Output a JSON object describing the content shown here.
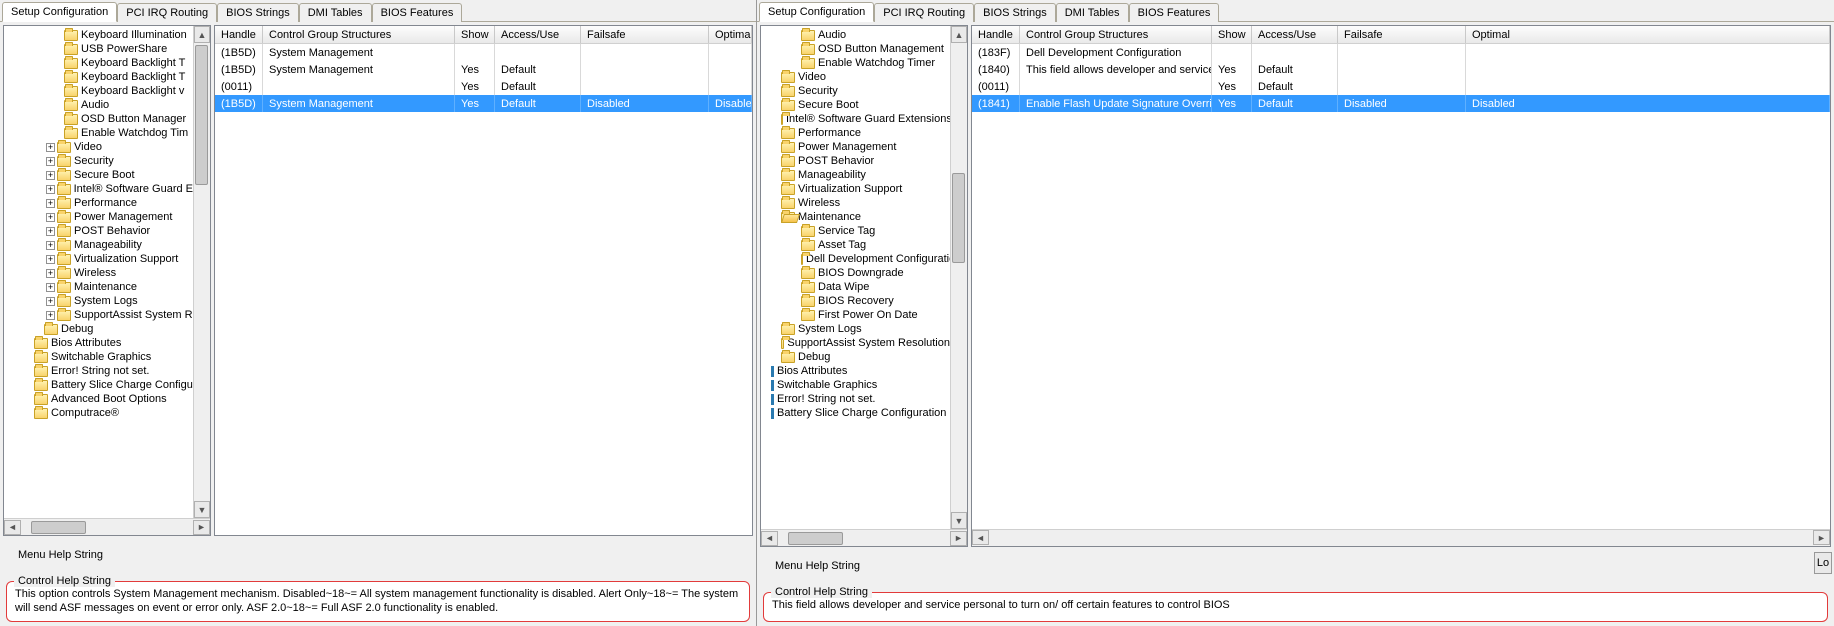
{
  "tabs": [
    "Setup Configuration",
    "PCI IRQ Routing",
    "BIOS Strings",
    "DMI Tables",
    "BIOS Features"
  ],
  "columns": [
    "Handle",
    "Control Group Structures",
    "Show",
    "Access/Use",
    "Failsafe",
    "Optimal"
  ],
  "left": {
    "tree": [
      {
        "indent": 6,
        "folder": "closed",
        "label": "Keyboard Illumination"
      },
      {
        "indent": 6,
        "folder": "closed",
        "label": "USB PowerShare"
      },
      {
        "indent": 6,
        "folder": "closed",
        "label": "Keyboard Backlight T"
      },
      {
        "indent": 6,
        "folder": "closed",
        "label": "Keyboard Backlight T"
      },
      {
        "indent": 6,
        "folder": "closed",
        "label": "Keyboard Backlight v"
      },
      {
        "indent": 6,
        "folder": "closed",
        "label": "Audio"
      },
      {
        "indent": 6,
        "folder": "closed",
        "label": "OSD Button Manager"
      },
      {
        "indent": 6,
        "folder": "closed",
        "label": "Enable Watchdog Tim"
      },
      {
        "indent": 4,
        "expander": "+",
        "folder": "closed",
        "label": "Video"
      },
      {
        "indent": 4,
        "expander": "+",
        "folder": "closed",
        "label": "Security"
      },
      {
        "indent": 4,
        "expander": "+",
        "folder": "closed",
        "label": "Secure Boot"
      },
      {
        "indent": 4,
        "expander": "+",
        "folder": "closed",
        "label": "Intel® Software Guard E"
      },
      {
        "indent": 4,
        "expander": "+",
        "folder": "closed",
        "label": "Performance"
      },
      {
        "indent": 4,
        "expander": "+",
        "folder": "closed",
        "label": "Power Management"
      },
      {
        "indent": 4,
        "expander": "+",
        "folder": "closed",
        "label": "POST Behavior"
      },
      {
        "indent": 4,
        "expander": "+",
        "folder": "closed",
        "label": "Manageability"
      },
      {
        "indent": 4,
        "expander": "+",
        "folder": "closed",
        "label": "Virtualization Support"
      },
      {
        "indent": 4,
        "expander": "+",
        "folder": "closed",
        "label": "Wireless"
      },
      {
        "indent": 4,
        "expander": "+",
        "folder": "closed",
        "label": "Maintenance"
      },
      {
        "indent": 4,
        "expander": "+",
        "folder": "closed",
        "label": "System Logs"
      },
      {
        "indent": 4,
        "expander": "+",
        "folder": "closed",
        "label": "SupportAssist System R"
      },
      {
        "indent": 4,
        "folder": "closed",
        "label": "Debug"
      },
      {
        "indent": 3,
        "folder": "closed",
        "label": "Bios Attributes"
      },
      {
        "indent": 3,
        "folder": "closed",
        "label": "Switchable Graphics"
      },
      {
        "indent": 3,
        "folder": "closed",
        "label": "Error! String not set."
      },
      {
        "indent": 3,
        "folder": "closed",
        "label": "Battery Slice Charge Configu"
      },
      {
        "indent": 3,
        "folder": "closed",
        "label": "Advanced Boot Options"
      },
      {
        "indent": 3,
        "folder": "closed",
        "label": "Computrace®"
      }
    ],
    "rows": [
      {
        "handle": "(1B5D)",
        "cgs": "System Management",
        "show": "",
        "au": "",
        "fs": "",
        "opt": ""
      },
      {
        "handle": "(1B5D)",
        "cgs": "System Management",
        "show": "Yes",
        "au": "Default",
        "fs": "",
        "opt": ""
      },
      {
        "handle": "(0011)",
        "cgs": "",
        "show": "Yes",
        "au": "Default",
        "fs": "",
        "opt": ""
      },
      {
        "handle": "(1B5D)",
        "cgs": "System Management",
        "show": "Yes",
        "au": "Default",
        "fs": "Disabled",
        "opt": "Disabled",
        "sel": true
      }
    ],
    "menuHelp": "Menu Help String",
    "ctrlHelp": "Control Help String",
    "ctrlHelpText": "This option controls System Management mechanism.    Disabled~18~= All system management functionality is disabled.  Alert Only~18~= The system will send ASF messages on event or error only.  ASF 2.0~18~= Full ASF 2.0 functionality is enabled."
  },
  "right": {
    "tree": [
      {
        "indent": 4,
        "folder": "closed",
        "label": "Audio"
      },
      {
        "indent": 4,
        "folder": "closed",
        "label": "OSD Button Management"
      },
      {
        "indent": 4,
        "folder": "closed",
        "label": "Enable Watchdog Timer"
      },
      {
        "indent": 2,
        "folder": "closed",
        "label": "Video"
      },
      {
        "indent": 2,
        "folder": "closed",
        "label": "Security"
      },
      {
        "indent": 2,
        "folder": "closed",
        "label": "Secure Boot"
      },
      {
        "indent": 2,
        "folder": "closed",
        "label": "Intel® Software Guard Extensions™"
      },
      {
        "indent": 2,
        "folder": "closed",
        "label": "Performance"
      },
      {
        "indent": 2,
        "folder": "closed",
        "label": "Power Management"
      },
      {
        "indent": 2,
        "folder": "closed",
        "label": "POST Behavior"
      },
      {
        "indent": 2,
        "folder": "closed",
        "label": "Manageability"
      },
      {
        "indent": 2,
        "folder": "closed",
        "label": "Virtualization Support"
      },
      {
        "indent": 2,
        "folder": "closed",
        "label": "Wireless"
      },
      {
        "indent": 2,
        "folder": "open",
        "label": "Maintenance"
      },
      {
        "indent": 4,
        "folder": "closed",
        "label": "Service Tag"
      },
      {
        "indent": 4,
        "folder": "closed",
        "label": "Asset Tag"
      },
      {
        "indent": 4,
        "folder": "closed",
        "label": "Dell Development Configuration"
      },
      {
        "indent": 4,
        "folder": "closed",
        "label": "BIOS Downgrade"
      },
      {
        "indent": 4,
        "folder": "closed",
        "label": "Data Wipe"
      },
      {
        "indent": 4,
        "folder": "closed",
        "label": "BIOS Recovery"
      },
      {
        "indent": 4,
        "folder": "closed",
        "label": "First Power On Date"
      },
      {
        "indent": 2,
        "folder": "closed",
        "label": "System Logs"
      },
      {
        "indent": 2,
        "folder": "closed",
        "label": "SupportAssist System Resolution"
      },
      {
        "indent": 2,
        "folder": "closed",
        "label": "Debug"
      },
      {
        "indent": 1,
        "bar": true,
        "label": "Bios Attributes"
      },
      {
        "indent": 1,
        "bar": true,
        "label": "Switchable Graphics"
      },
      {
        "indent": 1,
        "bar": true,
        "label": "Error! String not set."
      },
      {
        "indent": 1,
        "bar": true,
        "label": "Battery Slice Charge Configuration"
      }
    ],
    "rows": [
      {
        "handle": "(183F)",
        "cgs": "Dell Development Configuration",
        "show": "",
        "au": "",
        "fs": "",
        "opt": ""
      },
      {
        "handle": "(1840)",
        "cgs": "This field allows developer and service p...",
        "show": "Yes",
        "au": "Default",
        "fs": "",
        "opt": ""
      },
      {
        "handle": "(0011)",
        "cgs": "",
        "show": "Yes",
        "au": "Default",
        "fs": "",
        "opt": ""
      },
      {
        "handle": "(1841)",
        "cgs": "Enable Flash Update Signature Override",
        "show": "Yes",
        "au": "Default",
        "fs": "Disabled",
        "opt": "Disabled",
        "sel": true
      }
    ],
    "menuHelp": "Menu Help String",
    "ctrlHelp": "Control Help String",
    "ctrlHelpText": "This field allows developer and service personal to turn on/ off certain features to control BIOS",
    "sideBtn": "Lo"
  }
}
